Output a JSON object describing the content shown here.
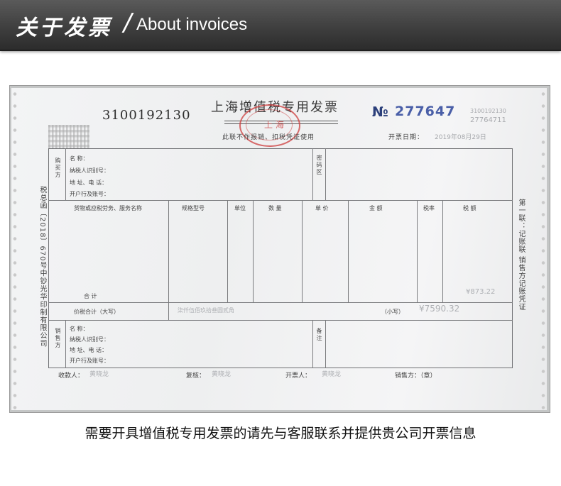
{
  "header": {
    "title_cn": "关于发票",
    "slash": "/",
    "title_en": "About invoices"
  },
  "invoice": {
    "code": "3100192130",
    "title": "上海增值税专用发票",
    "number_sign": "№",
    "number": "277647",
    "number_faint_1": "3100192130",
    "number_faint_2": "27764711",
    "usage_note": "此联不作报销、扣税凭证使用",
    "date_label": "开票日期：",
    "date_value": "2019年08月29日",
    "stamp_text": "上 海",
    "side_left": "税总函〔2018〕670号中钞光华印制有限公司",
    "side_right": "第一联：记账联 销售方记账凭证",
    "buyer": {
      "section": "购买方",
      "name": "名 称：",
      "tax_id": "纳税人识别号：",
      "address": "地 址、电 话：",
      "bank": "开户行及账号："
    },
    "cipher_area": "密码区",
    "columns": {
      "goods": "货物或应税劳务、服务名称",
      "spec": "规格型号",
      "unit": "单位",
      "qty": "数 量",
      "price": "单 价",
      "amount": "金 额",
      "rate": "税率",
      "tax": "税 额"
    },
    "total_label": "合 计",
    "total_tax": "¥873.22",
    "price_tax_total_label": "价税合计（大写）",
    "price_tax_total_caps": "柒仟伍佰玖拾叁圆贰角",
    "small_caps_label": "（小写）",
    "small_caps_value": "¥7590.32",
    "seller": {
      "section": "销售方",
      "name": "名 称：",
      "tax_id": "纳税人识别号：",
      "address": "地 址、电 话：",
      "bank": "开户行及账号："
    },
    "remarks": "备注",
    "payee_label": "收款人：",
    "payee_value": "黄晓龙",
    "reviewer_label": "复核：",
    "reviewer_value": "黄晓龙",
    "issuer_label": "开票人：",
    "issuer_value": "黄晓龙",
    "seller_stamp_label": "销售方：（章）"
  },
  "caption": "需要开具增值税专用发票的请先与客服联系并提供贵公司开票信息"
}
